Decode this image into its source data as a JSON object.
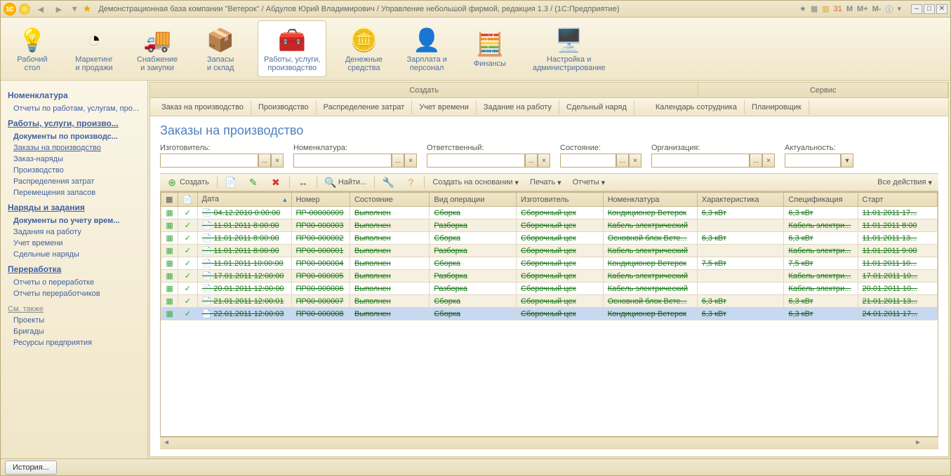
{
  "title": "Демонстрационная база компании \"Ветерок\" / Абдулов Юрий Владимирович / Управление небольшой фирмой, редакция 1.3 / (1С:Предприятие)",
  "tb_right": {
    "m": "M",
    "mp": "M+",
    "mm": "M-"
  },
  "ribbon": [
    {
      "l1": "Рабочий",
      "l2": "стол"
    },
    {
      "l1": "Маркетинг",
      "l2": "и продажи"
    },
    {
      "l1": "Снабжение",
      "l2": "и закупки"
    },
    {
      "l1": "Запасы",
      "l2": "и склад"
    },
    {
      "l1": "Работы, услуги,",
      "l2": "производство"
    },
    {
      "l1": "Денежные",
      "l2": "средства"
    },
    {
      "l1": "Зарплата и",
      "l2": "персонал"
    },
    {
      "l1": "Финансы",
      "l2": ""
    },
    {
      "l1": "Настройка и",
      "l2": "администрирование"
    }
  ],
  "sidebar": {
    "h1": "Номенклатура",
    "i1": "Отчеты по работам, услугам, про...",
    "h2": "Работы, услуги, произво...",
    "g1": [
      "Документы по производс...",
      "Заказы на производство",
      "Заказ-наряды",
      "Производство",
      "Распределения затрат",
      "Перемещения запасов"
    ],
    "h3": "Наряды и задания",
    "g2": [
      "Документы по учету врем...",
      "Задания на работу",
      "Учет времени",
      "Сдельные наряды"
    ],
    "h4": "Переработка",
    "g3": [
      "Отчеты о переработке",
      "Отчеты переработчиков"
    ],
    "h5": "См. также",
    "g4": [
      "Проекты",
      "Бригады",
      "Ресурсы предприятия"
    ]
  },
  "svc": {
    "create": "Создать",
    "service": "Сервис"
  },
  "tabs": [
    "Заказ на производство",
    "Производство",
    "Распределение затрат",
    "Учет времени",
    "Задание на работу",
    "Сдельный наряд",
    "Календарь сотрудника",
    "Планировщик"
  ],
  "page_title": "Заказы на производство",
  "filters": [
    {
      "label": "Изготовитель:",
      "w": 140
    },
    {
      "label": "Номенклатура:",
      "w": 140
    },
    {
      "label": "Ответственный:",
      "w": 140
    },
    {
      "label": "Состояние:",
      "w": 80
    },
    {
      "label": "Организация:",
      "w": 140
    },
    {
      "label": "Актуальность:",
      "w": 80,
      "drop": true
    }
  ],
  "toolbar": {
    "create": "Создать",
    "find": "Найти...",
    "base": "Создать на основании",
    "print": "Печать",
    "reports": "Отчеты",
    "all": "Все действия"
  },
  "cols": [
    "",
    "",
    "Дата",
    "Номер",
    "Состояние",
    "Вид операции",
    "Изготовитель",
    "Номенклатура",
    "Характеристика",
    "Спецификация",
    "Старт"
  ],
  "rows": [
    {
      "d": "04.12.2010 0:00:00",
      "n": "ПР-00000009",
      "s": "Выполнен",
      "op": "Сборка",
      "m": "Сборочный цех",
      "nm": "Кондиционер Ветерок",
      "ch": "6,3 кВт",
      "sp": "6,3 кВт",
      "st": "11.01.2011 17..."
    },
    {
      "d": "11.01.2011 8:00:00",
      "n": "ПР00-000003",
      "s": "Выполнен",
      "op": "Разборка",
      "m": "Сборочный цех",
      "nm": "Кабель электрический",
      "ch": "",
      "sp": "Кабель электри...",
      "st": "11.01.2011 8:00"
    },
    {
      "d": "11.01.2011 8:00:00",
      "n": "ПР00-000002",
      "s": "Выполнен",
      "op": "Сборка",
      "m": "Сборочный цех",
      "nm": "Основной блок Вете...",
      "ch": "6,3 кВт",
      "sp": "6,3 кВт",
      "st": "11.01.2011 13..."
    },
    {
      "d": "11.01.2011 8:00:00",
      "n": "ПР00-000001",
      "s": "Выполнен",
      "op": "Разборка",
      "m": "Сборочный цех",
      "nm": "Кабель электрический",
      "ch": "",
      "sp": "Кабель электри...",
      "st": "11.01.2011 9:00"
    },
    {
      "d": "11.01.2011 10:00:00",
      "n": "ПР00-000004",
      "s": "Выполнен",
      "op": "Сборка",
      "m": "Сборочный цех",
      "nm": "Кондиционер Ветерок",
      "ch": "7,5 кВт",
      "sp": "7,5 кВт",
      "st": "11.01.2011 10..."
    },
    {
      "d": "17.01.2011 12:00:00",
      "n": "ПР00-000005",
      "s": "Выполнен",
      "op": "Разборка",
      "m": "Сборочный цех",
      "nm": "Кабель электрический",
      "ch": "",
      "sp": "Кабель электри...",
      "st": "17.01.2011 10..."
    },
    {
      "d": "20.01.2011 12:00:00",
      "n": "ПР00-000006",
      "s": "Выполнен",
      "op": "Разборка",
      "m": "Сборочный цех",
      "nm": "Кабель электрический",
      "ch": "",
      "sp": "Кабель электри...",
      "st": "20.01.2011 10..."
    },
    {
      "d": "21.01.2011 12:00:01",
      "n": "ПР00-000007",
      "s": "Выполнен",
      "op": "Сборка",
      "m": "Сборочный цех",
      "nm": "Основной блок Вете...",
      "ch": "6,3 кВт",
      "sp": "6,3 кВт",
      "st": "21.01.2011 13..."
    },
    {
      "d": "22.01.2011 12:00:03",
      "n": "ПР00-000008",
      "s": "Выполнен",
      "op": "Сборка",
      "m": "Сборочный цех",
      "nm": "Кондиционер Ветерок",
      "ch": "6,3 кВт",
      "sp": "6,3 кВт",
      "st": "24.01.2011 17..."
    }
  ],
  "footer": {
    "history": "История..."
  }
}
